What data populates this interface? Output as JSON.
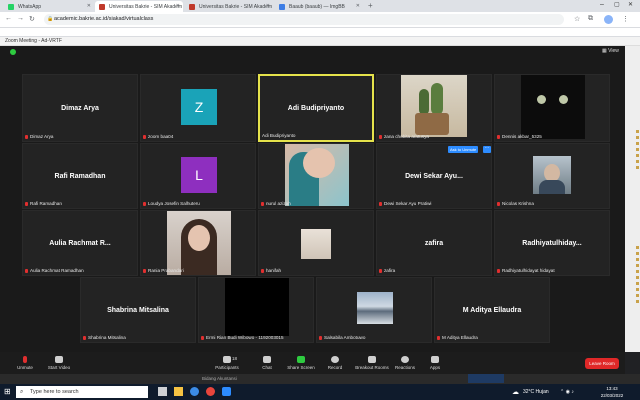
{
  "browser": {
    "tabs": [
      {
        "label": "WhatsApp"
      },
      {
        "label": "Universitas Bakrie - SIM Akadem"
      },
      {
        "label": "Universitas Bakrie - SIM Akadem"
      },
      {
        "label": "Baaub (baaub) — ImgBB"
      }
    ],
    "url": "academic.bakrie.ac.id/siakad/virtualclass"
  },
  "zoom": {
    "window_title": "Zoom Meeting - Ad-VRTF",
    "view_label": "View",
    "ask_to_unmute": "Ask to Unmute",
    "participants": [
      {
        "display": "Dimaz Arya",
        "tag": "Dimaz Arya"
      },
      {
        "display": "Z",
        "tag": "zoom baa04"
      },
      {
        "display": "Adi Budipriyanto",
        "tag": "Adi Budipriyanto"
      },
      {
        "display": "",
        "tag": "zana chobita aratusya"
      },
      {
        "display": "",
        "tag": "Dennis akbar_5325"
      },
      {
        "display": "Rafi Ramadhan",
        "tag": "Rafi Ramadhan"
      },
      {
        "display": "L",
        "tag": "Loudya Josefin Salhuteru"
      },
      {
        "display": "",
        "tag": "nurul azizah"
      },
      {
        "display": "Dewi Sekar Ayu...",
        "tag": "Dewi Sekar Ayu Pratiwi"
      },
      {
        "display": "",
        "tag": "Nicolas Krishna"
      },
      {
        "display": "Aulia Rachmat R...",
        "tag": "Aulia Rachmat Ramadhan"
      },
      {
        "display": "",
        "tag": "Rania Prabandari"
      },
      {
        "display": "",
        "tag": "hanifah"
      },
      {
        "display": "zafira",
        "tag": "zafira"
      },
      {
        "display": "Radhiyatulhiday...",
        "tag": "Radhiyatulhidayat hidayat"
      },
      {
        "display": "Shabrina Mitsalina",
        "tag": "Shabrina Mitsalina"
      },
      {
        "display": "",
        "tag": "Ermi Rian Budi Wibowo - 1192003015"
      },
      {
        "display": "",
        "tag": "Salsabila Ambotuwo"
      },
      {
        "display": "M Aditya Ellaudra",
        "tag": "M Aditya Ellaudra"
      }
    ],
    "toolbar": {
      "unmute": "Unmute",
      "start_video": "Start Video",
      "participants": "Participants",
      "participants_count": "18",
      "chat": "Chat",
      "share_screen": "Share Screen",
      "record": "Record",
      "breakout_rooms": "Breakout Rooms",
      "reactions": "Reactions",
      "apps": "Apps",
      "leave_room": "Leave Room"
    },
    "below_text": "Bidang Akuntansi"
  },
  "taskbar": {
    "search_placeholder": "Type here to search",
    "weather": "32°C  Hujan",
    "time": "13:43",
    "date": "22/03/2022"
  },
  "colors": {
    "active_speaker_border": "#e5e24b",
    "avatar_z": "#1aa3b8",
    "avatar_l": "#8e2fbf",
    "leave_button": "#e02828",
    "mic_muted": "#e02f2f"
  }
}
